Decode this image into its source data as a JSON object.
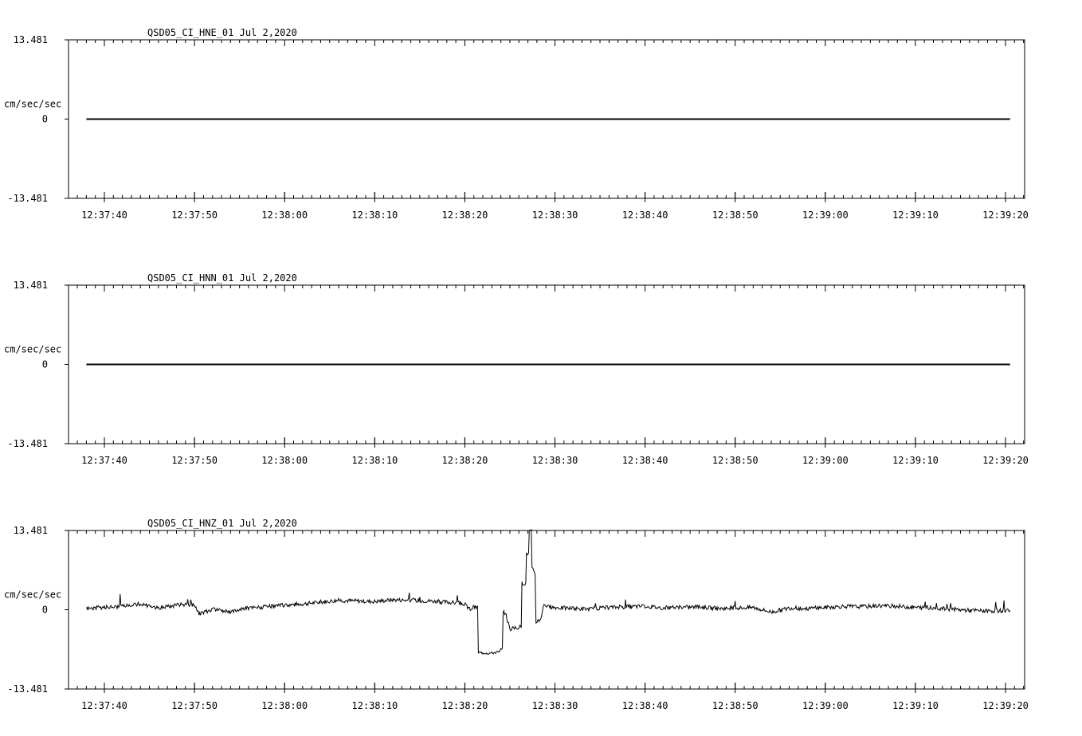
{
  "chart_data": [
    {
      "type": "line",
      "title": "QSD05_CI_HNE_01  Jul 2,2020",
      "ylabel": "cm/sec/sec",
      "ylim": [
        -13.481,
        13.481
      ],
      "y_tick_labels": [
        "13.481",
        "0",
        "-13.481"
      ],
      "x_tick_labels": [
        "12:37:40",
        "12:37:50",
        "12:38:00",
        "12:38:10",
        "12:38:20",
        "12:38:30",
        "12:38:40",
        "12:38:50",
        "12:39:00",
        "12:39:10",
        "12:39:20"
      ],
      "xlim_seconds": [
        -4,
        102
      ],
      "series": [
        {
          "x": [
            -2,
            100.5
          ],
          "y": [
            0,
            0
          ]
        }
      ]
    },
    {
      "type": "line",
      "title": "QSD05_CI_HNN_01  Jul 2,2020",
      "ylabel": "cm/sec/sec",
      "ylim": [
        -13.481,
        13.481
      ],
      "y_tick_labels": [
        "13.481",
        "0",
        "-13.481"
      ],
      "x_tick_labels": [
        "12:37:40",
        "12:37:50",
        "12:38:00",
        "12:38:10",
        "12:38:20",
        "12:38:30",
        "12:38:40",
        "12:38:50",
        "12:39:00",
        "12:39:10",
        "12:39:20"
      ],
      "xlim_seconds": [
        -4,
        102
      ],
      "series": [
        {
          "x": [
            -2,
            100.5
          ],
          "y": [
            0,
            0
          ]
        }
      ]
    },
    {
      "type": "line",
      "title": "QSD05_CI_HNZ_01  Jul 2,2020",
      "ylabel": "cm/sec/sec",
      "ylim": [
        -13.481,
        13.481
      ],
      "y_tick_labels": [
        "13.481",
        "0",
        "-13.481"
      ],
      "x_tick_labels": [
        "12:37:40",
        "12:37:50",
        "12:38:00",
        "12:38:10",
        "12:38:20",
        "12:38:30",
        "12:38:40",
        "12:38:50",
        "12:39:00",
        "12:39:10",
        "12:39:20"
      ],
      "xlim_seconds": [
        -4,
        102
      ],
      "series": [
        {
          "x": [
            -2,
            0,
            2,
            4,
            6,
            8,
            10,
            10.5,
            12,
            14,
            16,
            18,
            20,
            22,
            24,
            26,
            28,
            30,
            32,
            34,
            36,
            38,
            40,
            40.3,
            40.6,
            41,
            42,
            43,
            43.5,
            43.8,
            44,
            44.5,
            45,
            46,
            46.6,
            47.0,
            47.3,
            47.6,
            47.8,
            48.0,
            48.4,
            48.8,
            49.2,
            50,
            52,
            54,
            56,
            58,
            60,
            62,
            64,
            66,
            68,
            70,
            72,
            74,
            76,
            78,
            80,
            82,
            84,
            86,
            88,
            90,
            92,
            94,
            96,
            98,
            100.5
          ],
          "y": [
            0.2,
            0.4,
            0.6,
            1.0,
            0.3,
            0.8,
            0.9,
            -0.8,
            0.1,
            -0.3,
            0.3,
            0.5,
            0.8,
            1.0,
            1.3,
            1.6,
            1.5,
            1.4,
            1.7,
            1.6,
            1.5,
            1.3,
            1.0,
            0.3,
            0.1,
            0.4,
            -7.3,
            -7.4,
            -7.2,
            -7.3,
            -6.8,
            -0.5,
            -3.3,
            -3.0,
            4.5,
            9.5,
            13.4,
            7.0,
            6.0,
            -2.0,
            -1.6,
            1.0,
            0.5,
            0.4,
            0.2,
            0.1,
            0.4,
            0.5,
            0.6,
            0.3,
            0.4,
            0.5,
            0.2,
            0.3,
            0.4,
            -0.4,
            0.3,
            0.2,
            0.4,
            0.6,
            0.5,
            0.7,
            0.6,
            0.4,
            0.3,
            0.1,
            -0.1,
            -0.2,
            -0.1
          ]
        }
      ]
    }
  ]
}
